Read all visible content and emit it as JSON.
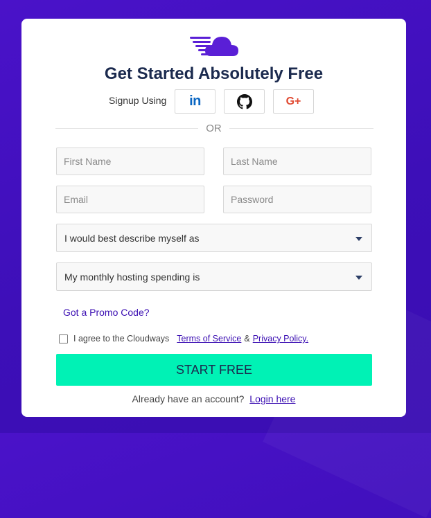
{
  "brand": {
    "accent": "#3a0db2",
    "cta_color": "#00f2b5"
  },
  "header": {
    "title": "Get Started Absolutely Free",
    "logo": "cloudways-cloud-logo"
  },
  "social": {
    "label": "Signup Using",
    "buttons": [
      {
        "name": "linkedin",
        "icon": "linkedin-icon",
        "text": "in"
      },
      {
        "name": "github",
        "icon": "github-icon"
      },
      {
        "name": "google-plus",
        "icon": "google-plus-icon",
        "text": "G+"
      }
    ]
  },
  "divider": {
    "text": "OR"
  },
  "form": {
    "first_name": {
      "placeholder": "First Name",
      "value": ""
    },
    "last_name": {
      "placeholder": "Last Name",
      "value": ""
    },
    "email": {
      "placeholder": "Email",
      "value": ""
    },
    "password": {
      "placeholder": "Password",
      "value": ""
    },
    "describe_select": {
      "selected": "I would best describe myself as"
    },
    "spending_select": {
      "selected": "My monthly hosting spending is"
    }
  },
  "promo": {
    "label": "Got a Promo Code?"
  },
  "terms": {
    "prefix": "I agree to the Cloudways",
    "terms_link": "Terms of Service",
    "amp": "&",
    "privacy_link": "Privacy Policy."
  },
  "cta": {
    "label": "START FREE"
  },
  "footer": {
    "prompt": "Already have an account?",
    "login_link": "Login here"
  }
}
